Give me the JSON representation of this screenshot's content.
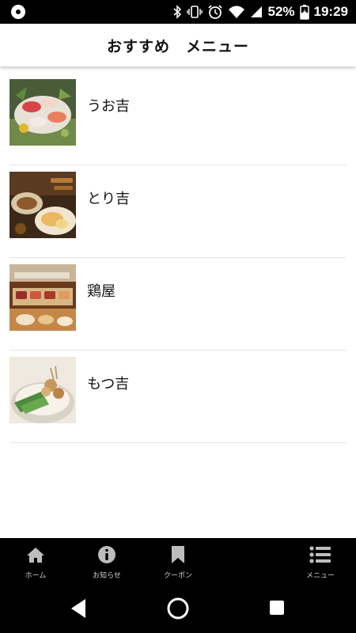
{
  "status_bar": {
    "battery_percent": "52%",
    "time": "19:29",
    "icons": [
      "app-indicator-icon",
      "bluetooth-icon",
      "vibrate-icon",
      "alarm-icon",
      "wifi-icon",
      "signal-icon",
      "battery-charging-icon"
    ]
  },
  "header": {
    "title": "おすすめ　メニュー"
  },
  "menu": {
    "items": [
      {
        "label": "うお吉",
        "image": "sashimi-photo"
      },
      {
        "label": "とり吉",
        "image": "chicken-dishes-photo"
      },
      {
        "label": "鶏屋",
        "image": "grilled-chicken-photo"
      },
      {
        "label": "もつ吉",
        "image": "motsu-nabe-photo"
      }
    ]
  },
  "tab_bar": {
    "tabs": [
      {
        "label": "ホーム",
        "icon": "home-icon"
      },
      {
        "label": "お知らせ",
        "icon": "info-icon"
      },
      {
        "label": "クーポン",
        "icon": "bookmark-icon"
      },
      {
        "label": "メニュー",
        "icon": "list-icon"
      }
    ]
  },
  "nav_bar": {
    "buttons": [
      "back-icon",
      "home-circle-icon",
      "recents-icon"
    ]
  }
}
